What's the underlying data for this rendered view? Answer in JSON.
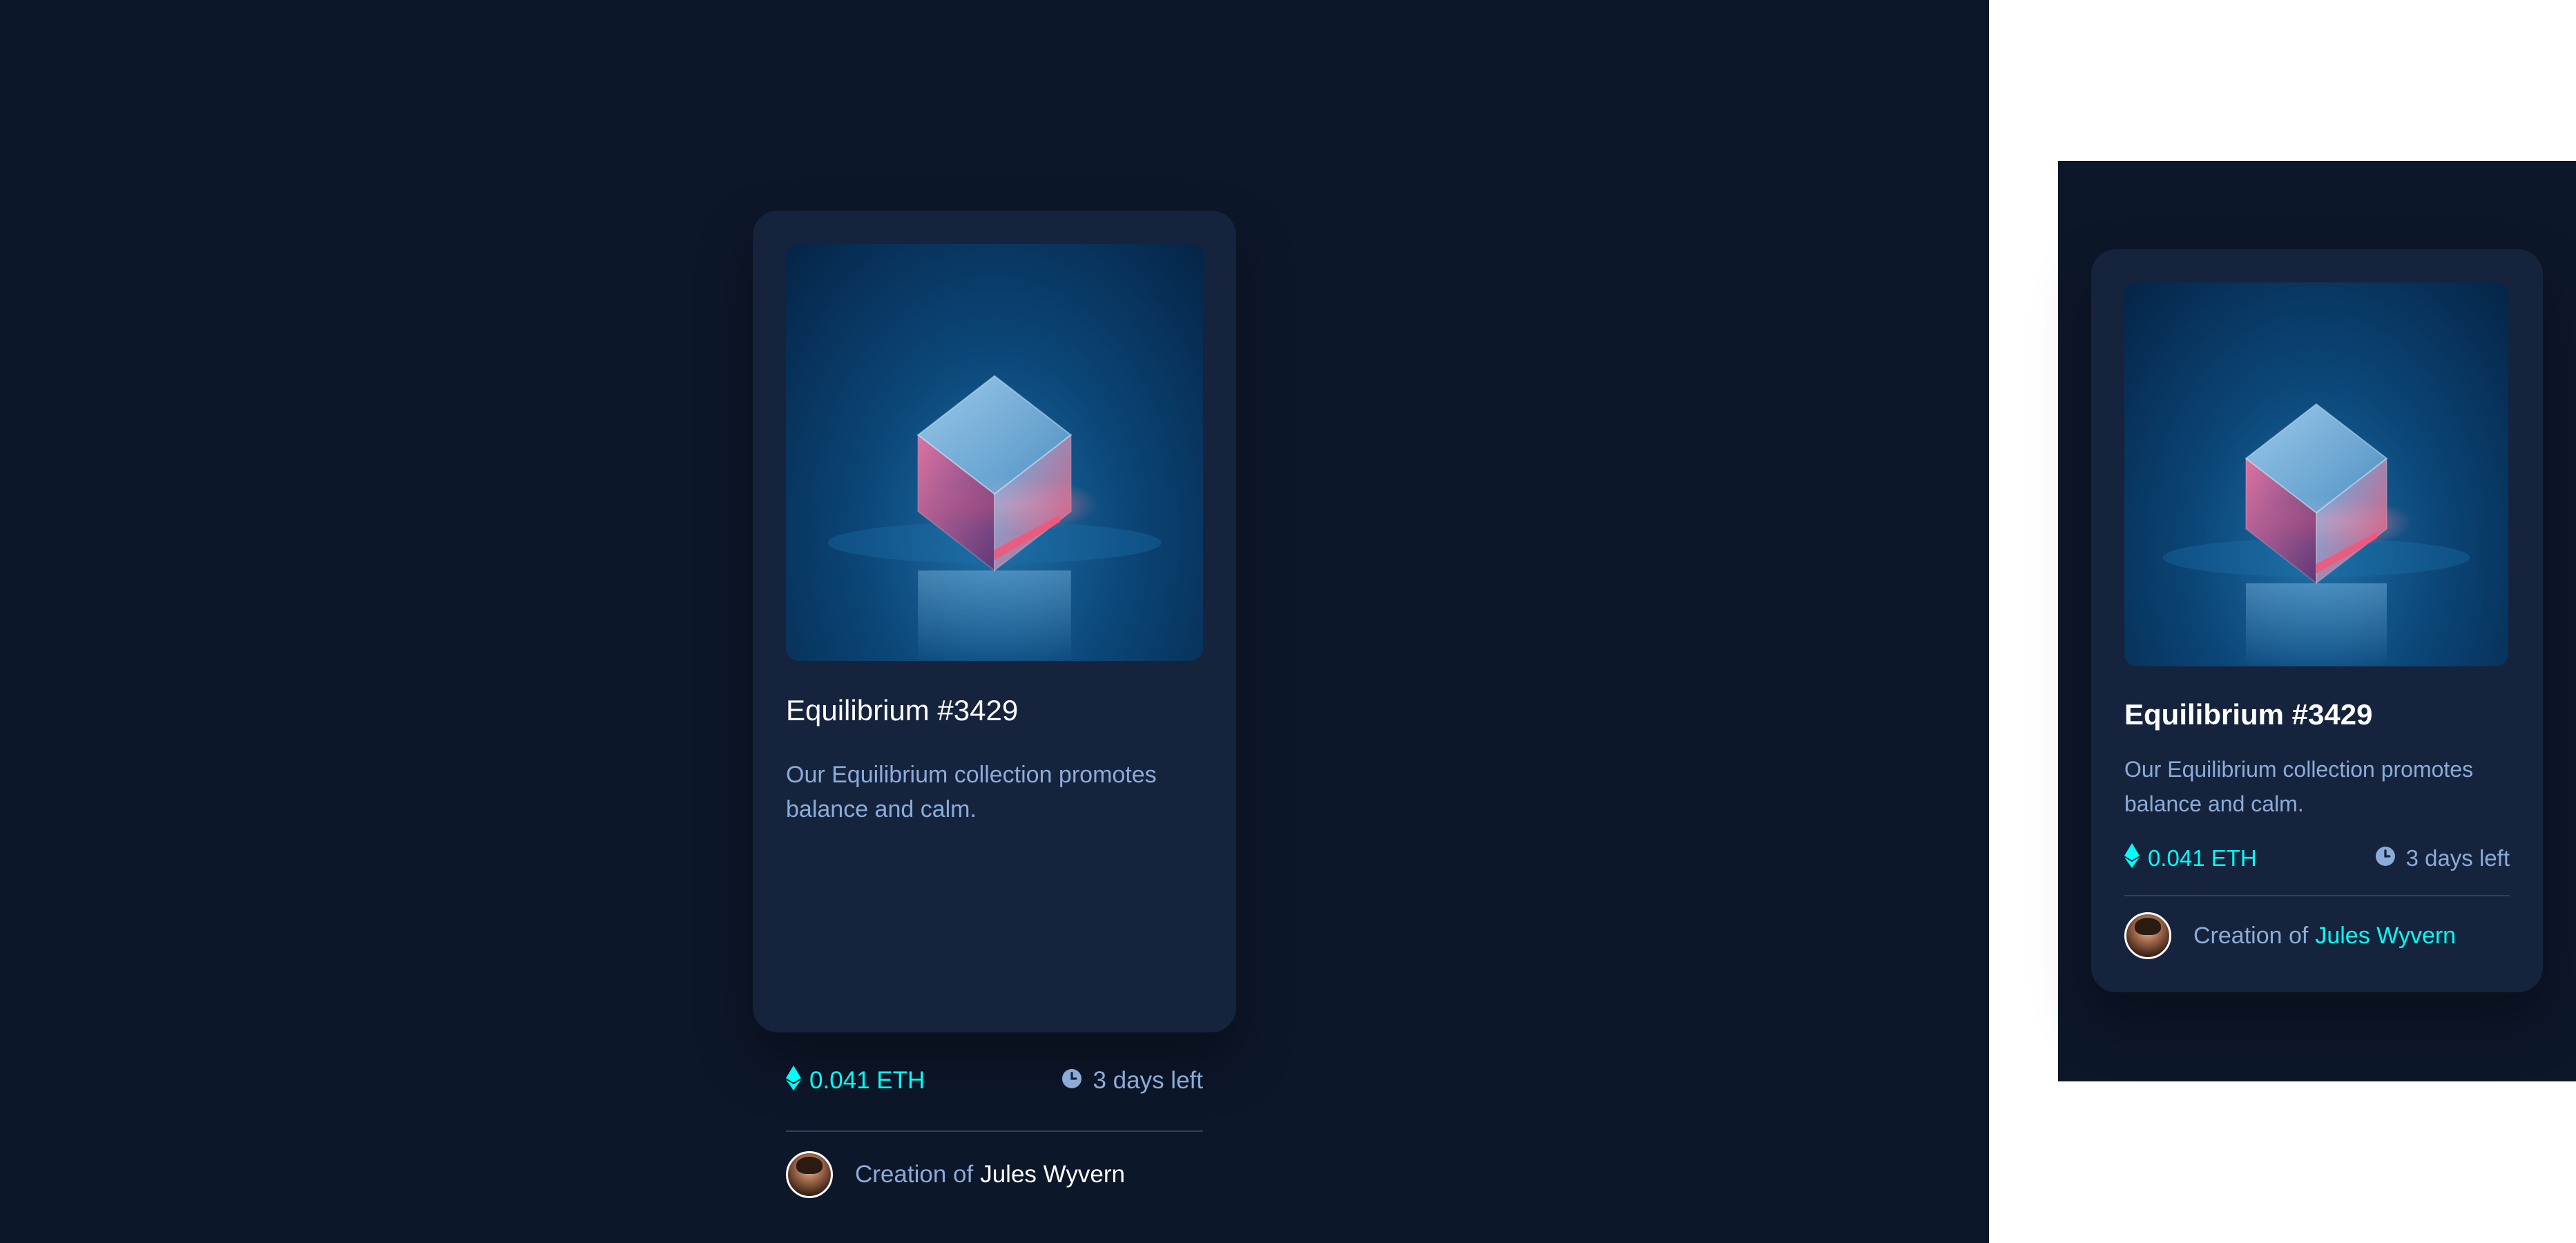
{
  "cards": [
    {
      "title": "Equilibrium #3429",
      "description": "Our Equilibrium collection promotes balance and calm.",
      "price": "0.041 ETH",
      "time_left": "3 days left",
      "creator_prefix": "Creation of",
      "creator_name": "Jules Wyvern",
      "image_alt": "cube-image",
      "icons": {
        "price": "ethereum-icon",
        "time": "clock-icon"
      }
    },
    {
      "title": "Equilibrium #3429",
      "description": "Our Equilibrium collection promotes balance and calm.",
      "price": "0.041 ETH",
      "time_left": "3 days left",
      "creator_prefix": "Creation of",
      "creator_name": "Jules Wyvern",
      "image_alt": "cube-image",
      "icons": {
        "price": "ethereum-icon",
        "time": "clock-icon"
      }
    }
  ],
  "colors": {
    "background": "#0d172a",
    "card": "#15233d",
    "cyan": "#00fff8",
    "soft_blue": "#8bacd9",
    "white": "#ffffff"
  }
}
